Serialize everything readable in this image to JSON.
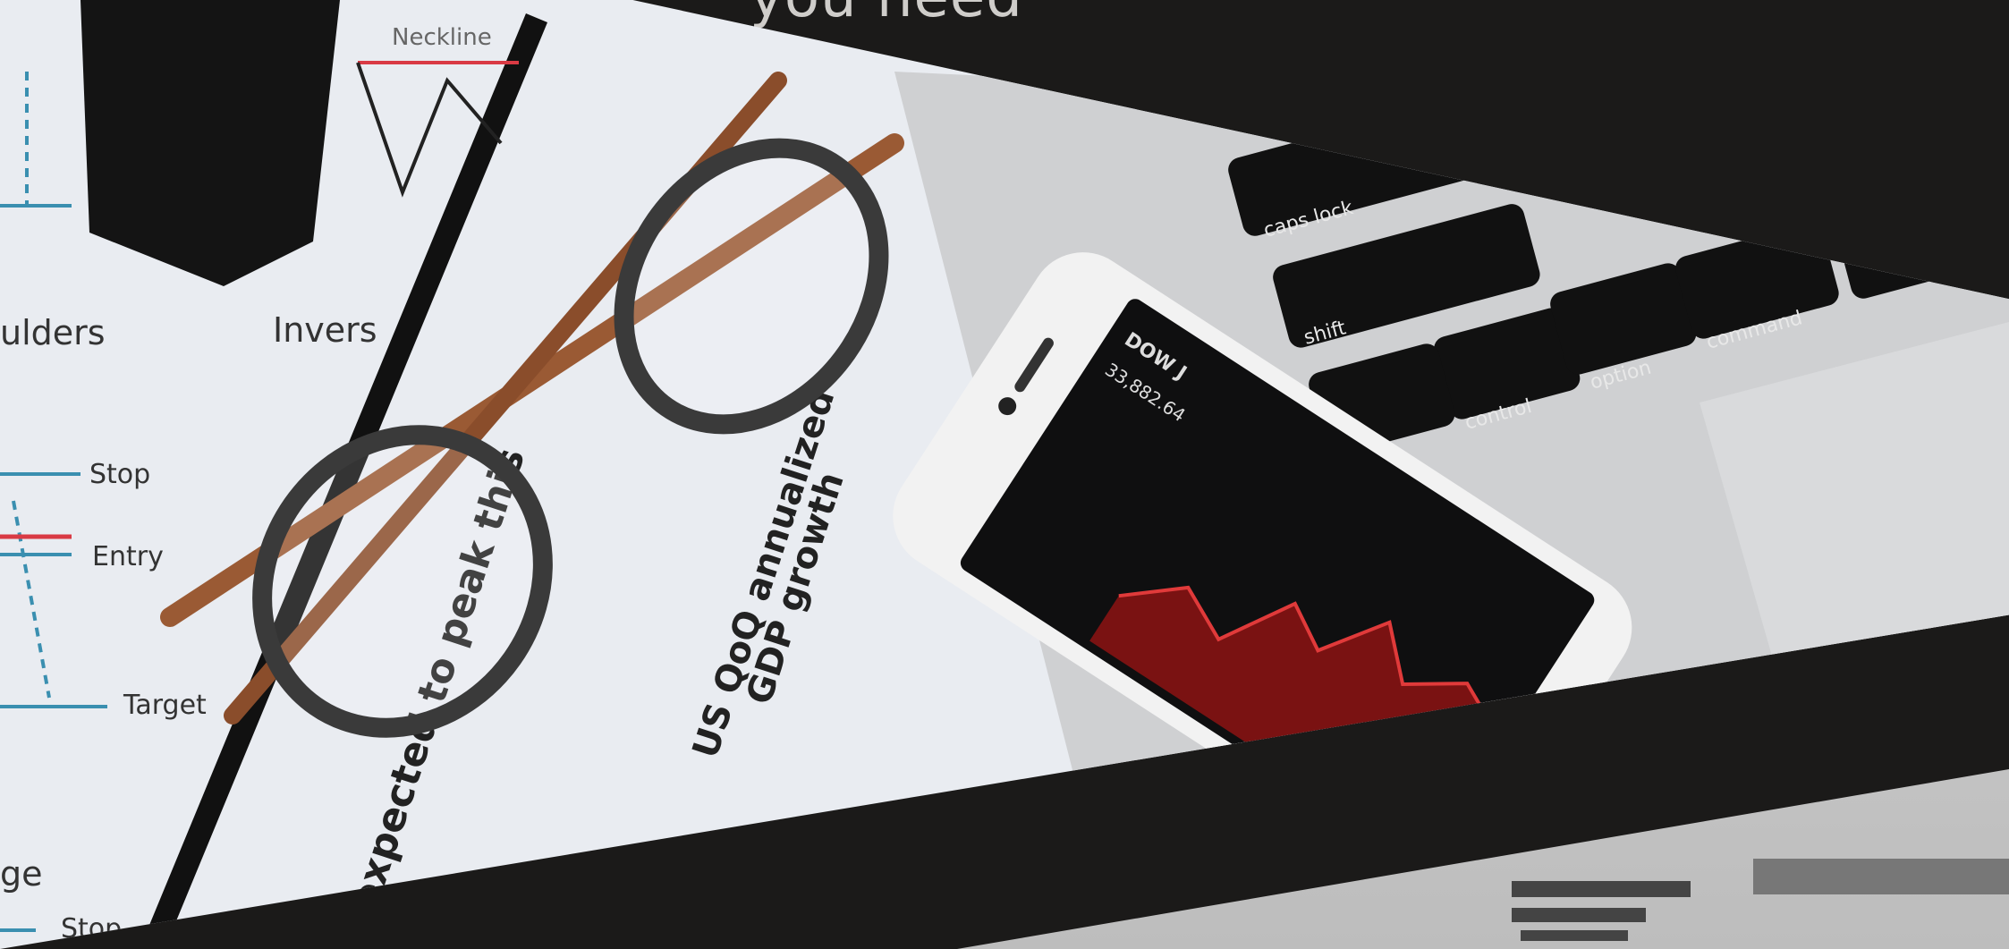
{
  "section": {
    "heading": "you need"
  },
  "photo": {
    "chart_labels": {
      "neckline": "Neckline",
      "shoulders": "ulders",
      "inverse": "Invers",
      "stop": "Stop",
      "entry": "Entry",
      "target": "Target",
      "range": "ge",
      "stop_bottom": "Stop"
    },
    "paper_text": {
      "headline": "US QoQ annualized",
      "headline2": "GDP growth",
      "expected": "expected to peak this"
    },
    "keyboard": {
      "caps": "caps lock",
      "shift": "shift",
      "control": "control",
      "option": "option",
      "command": "command"
    },
    "phone": {
      "ticker": "DOW J",
      "value": "33,882.64"
    }
  },
  "colors": {
    "background": "#1b1a19",
    "heading": "#cfcdca"
  }
}
